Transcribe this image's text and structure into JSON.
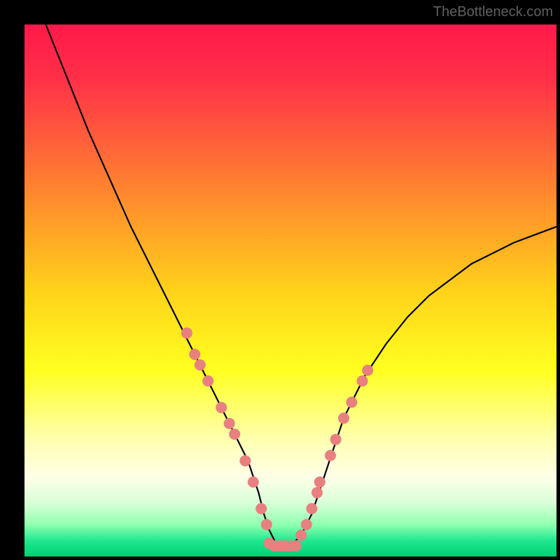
{
  "watermark": "TheBottleneck.com",
  "chart_data": {
    "type": "line",
    "title": "",
    "xlabel": "",
    "ylabel": "",
    "xlim": [
      0,
      100
    ],
    "ylim": [
      0,
      100
    ],
    "gradient_stops": [
      {
        "pos": 0.0,
        "color": "#ff1a4a"
      },
      {
        "pos": 0.1,
        "color": "#ff2f48"
      },
      {
        "pos": 0.3,
        "color": "#ff8030"
      },
      {
        "pos": 0.5,
        "color": "#ffd21a"
      },
      {
        "pos": 0.65,
        "color": "#ffff20"
      },
      {
        "pos": 0.78,
        "color": "#ffffb0"
      },
      {
        "pos": 0.85,
        "color": "#ffffe8"
      },
      {
        "pos": 0.9,
        "color": "#d8ffd8"
      },
      {
        "pos": 0.94,
        "color": "#90ffb0"
      },
      {
        "pos": 0.97,
        "color": "#20e890"
      },
      {
        "pos": 1.0,
        "color": "#00d070"
      }
    ],
    "series": [
      {
        "name": "bottleneck-curve",
        "color": "#000000",
        "x": [
          4,
          8,
          12,
          16,
          20,
          24,
          28,
          32,
          36,
          38,
          40,
          42,
          44,
          45,
          46,
          47,
          48,
          49,
          50,
          52,
          54,
          56,
          58,
          60,
          64,
          68,
          72,
          76,
          80,
          84,
          88,
          92,
          96,
          100
        ],
        "y": [
          100,
          90,
          80,
          71,
          62,
          54,
          46,
          38,
          30,
          26,
          22,
          18,
          12,
          8,
          5,
          3,
          2,
          2,
          2,
          4,
          8,
          14,
          20,
          26,
          34,
          40,
          45,
          49,
          52,
          55,
          57,
          59,
          60.5,
          62
        ]
      }
    ],
    "markers": [
      {
        "x": 30.5,
        "y": 42
      },
      {
        "x": 32.0,
        "y": 38
      },
      {
        "x": 33.0,
        "y": 36
      },
      {
        "x": 34.5,
        "y": 33
      },
      {
        "x": 37.0,
        "y": 28
      },
      {
        "x": 38.5,
        "y": 25
      },
      {
        "x": 39.5,
        "y": 23
      },
      {
        "x": 41.5,
        "y": 18
      },
      {
        "x": 43.0,
        "y": 14
      },
      {
        "x": 44.5,
        "y": 9
      },
      {
        "x": 45.5,
        "y": 6
      },
      {
        "x": 46.0,
        "y": 2.5
      },
      {
        "x": 47.0,
        "y": 2
      },
      {
        "x": 48.0,
        "y": 2
      },
      {
        "x": 49.0,
        "y": 2
      },
      {
        "x": 50.0,
        "y": 2
      },
      {
        "x": 51.0,
        "y": 2
      },
      {
        "x": 52.0,
        "y": 4
      },
      {
        "x": 53.0,
        "y": 6
      },
      {
        "x": 54.0,
        "y": 9
      },
      {
        "x": 55.0,
        "y": 12
      },
      {
        "x": 55.5,
        "y": 14
      },
      {
        "x": 57.5,
        "y": 19
      },
      {
        "x": 58.5,
        "y": 22
      },
      {
        "x": 60.0,
        "y": 26
      },
      {
        "x": 61.5,
        "y": 29
      },
      {
        "x": 63.5,
        "y": 33
      },
      {
        "x": 64.5,
        "y": 35
      }
    ],
    "marker_color": "#e88080",
    "marker_radius": 8
  }
}
